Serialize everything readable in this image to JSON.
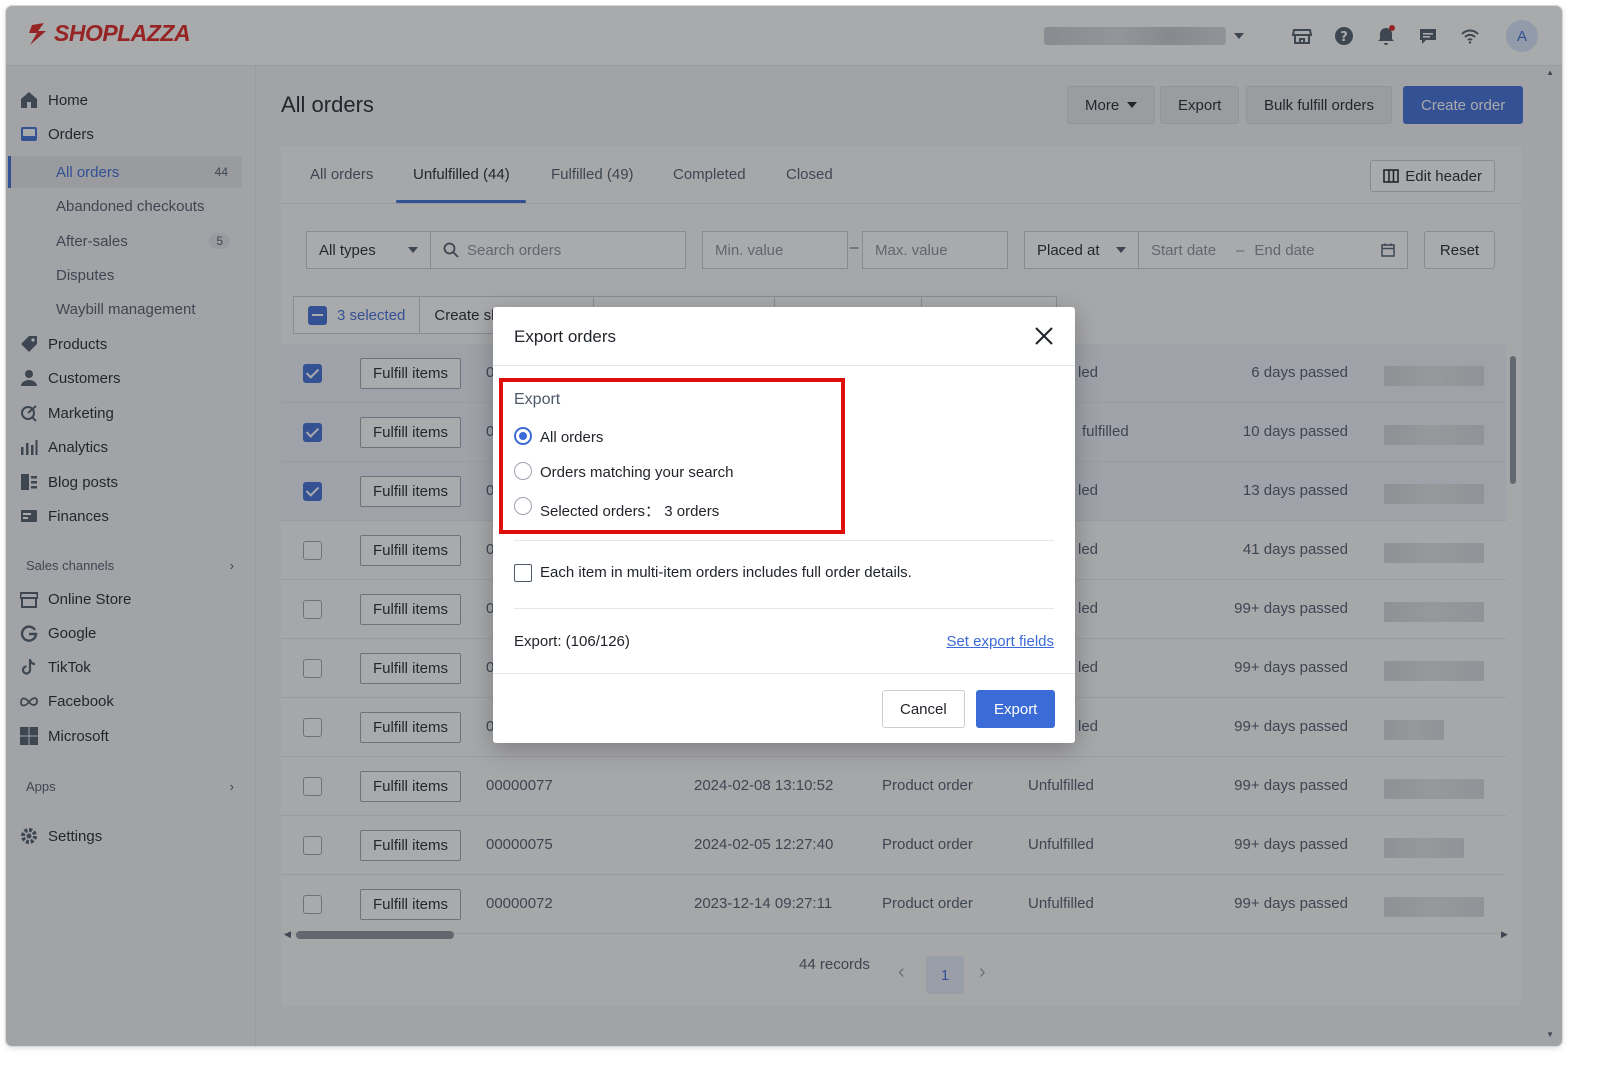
{
  "header": {
    "brand": "SHOPLAZZA",
    "avatar_letter": "A",
    "icons": [
      "store-icon",
      "help-icon",
      "bell-icon",
      "chat-icon",
      "wifi-icon"
    ]
  },
  "sidebar": {
    "items": [
      {
        "label": "Home",
        "icon": "home-icon"
      },
      {
        "label": "Orders",
        "icon": "orders-icon"
      },
      {
        "label": "Products",
        "icon": "tag-icon"
      },
      {
        "label": "Customers",
        "icon": "person-icon"
      },
      {
        "label": "Marketing",
        "icon": "marketing-icon"
      },
      {
        "label": "Analytics",
        "icon": "bar-chart-icon"
      },
      {
        "label": "Blog posts",
        "icon": "blog-icon"
      },
      {
        "label": "Finances",
        "icon": "finance-icon"
      }
    ],
    "order_subitems": [
      {
        "label": "All orders",
        "count": "44"
      },
      {
        "label": "Abandoned checkouts",
        "count": ""
      },
      {
        "label": "After-sales",
        "count": "5"
      },
      {
        "label": "Disputes",
        "count": ""
      },
      {
        "label": "Waybill management",
        "count": ""
      }
    ],
    "sales_channels_label": "Sales channels",
    "channels": [
      {
        "label": "Online Store",
        "icon": "store-icon"
      },
      {
        "label": "Google",
        "icon": "google-icon"
      },
      {
        "label": "TikTok",
        "icon": "tiktok-icon"
      },
      {
        "label": "Facebook",
        "icon": "meta-icon"
      },
      {
        "label": "Microsoft",
        "icon": "microsoft-icon"
      }
    ],
    "apps_label": "Apps",
    "settings_label": "Settings"
  },
  "main": {
    "title": "All orders",
    "more_label": "More",
    "export_label": "Export",
    "bulk_fulfill_label": "Bulk fulfill orders",
    "create_order_label": "Create order",
    "tabs": [
      "All orders",
      "Unfulfilled (44)",
      "Fulfilled (49)",
      "Completed",
      "Closed"
    ],
    "edit_header_label": "Edit header",
    "filters": {
      "type": "All types",
      "search_placeholder": "Search orders",
      "min_placeholder": "Min. value",
      "max_placeholder": "Max. value",
      "date_field": "Placed at",
      "start_placeholder": "Start date",
      "end_placeholder": "End date",
      "reset_label": "Reset"
    },
    "bulk": {
      "selected": "3 selected",
      "create_label": "Create sh"
    },
    "fulfill_label": "Fulfill items",
    "rows": [
      {
        "checked": true,
        "order": "0",
        "date": "",
        "type": "",
        "status": "led",
        "age": "6 days passed"
      },
      {
        "checked": true,
        "order": "0",
        "date": "",
        "type": "",
        "status": "fulfilled",
        "age": "10 days passed"
      },
      {
        "checked": true,
        "order": "0",
        "date": "",
        "type": "",
        "status": "led",
        "age": "13 days passed"
      },
      {
        "checked": false,
        "order": "0",
        "date": "",
        "type": "",
        "status": "led",
        "age": "41 days passed"
      },
      {
        "checked": false,
        "order": "0",
        "date": "",
        "type": "",
        "status": "led",
        "age": "99+ days passed"
      },
      {
        "checked": false,
        "order": "0",
        "date": "",
        "type": "",
        "status": "led",
        "age": "99+ days passed"
      },
      {
        "checked": false,
        "order": "0",
        "date": "",
        "type": "",
        "status": "led",
        "age": "99+ days passed"
      },
      {
        "checked": false,
        "order": "00000077",
        "date": "2024-02-08 13:10:52",
        "type": "Product order",
        "status": "Unfulfilled",
        "age": "99+ days passed"
      },
      {
        "checked": false,
        "order": "00000075",
        "date": "2024-02-05 12:27:40",
        "type": "Product order",
        "status": "Unfulfilled",
        "age": "99+ days passed"
      },
      {
        "checked": false,
        "order": "00000072",
        "date": "2023-12-14 09:27:11",
        "type": "Product order",
        "status": "Unfulfilled",
        "age": "99+ days passed"
      }
    ],
    "records_label": "44 records",
    "current_page": "1"
  },
  "modal": {
    "title": "Export orders",
    "section_label": "Export",
    "options": [
      {
        "label": "All orders",
        "selected": true
      },
      {
        "label": "Orders matching your search",
        "selected": false
      },
      {
        "label": "Selected orders： 3 orders",
        "selected": false
      }
    ],
    "checkbox_label": "Each item in multi-item orders includes full order details.",
    "count_label": "Export: (106/126)",
    "set_fields_label": "Set export fields",
    "cancel_label": "Cancel",
    "export_label": "Export"
  },
  "colors": {
    "accent": "#3b6bd6",
    "brand": "#e0211f",
    "highlight": "#e00d0d"
  }
}
